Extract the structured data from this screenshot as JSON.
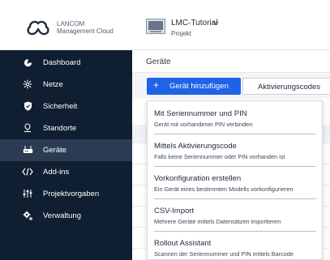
{
  "brand": {
    "line1": "LANCOM",
    "line2": "Management Cloud"
  },
  "project": {
    "name": "LMC-Tutorial",
    "subtitle": "Projekt",
    "chevron": "⌵"
  },
  "sidebar": {
    "items": [
      {
        "label": "Dashboard",
        "icon": "dashboard-gauge-icon",
        "active": false
      },
      {
        "label": "Netze",
        "icon": "network-icon",
        "active": false
      },
      {
        "label": "Sicherheit",
        "icon": "shield-icon",
        "active": false
      },
      {
        "label": "Standorte",
        "icon": "location-pin-icon",
        "active": false
      },
      {
        "label": "Geräte",
        "icon": "device-icon",
        "active": true
      },
      {
        "label": "Add-ins",
        "icon": "code-icon",
        "active": false
      },
      {
        "label": "Projektvorgaben",
        "icon": "sliders-icon",
        "active": false
      },
      {
        "label": "Verwaltung",
        "icon": "gears-icon",
        "active": false
      }
    ]
  },
  "main": {
    "breadcrumb": "Geräte",
    "add_button_label": "Gerät hinzufügen",
    "activation_button_label": "Aktivierungscodes"
  },
  "dropdown": {
    "items": [
      {
        "title": "Mit Seriennummer und PIN",
        "desc": "Gerät mit vorhandener PIN verbinden"
      },
      {
        "title": "Mittels Aktivierungscode",
        "desc": "Falls keine Seriennummer oder PIN vorhanden ist"
      },
      {
        "title": "Vorkonfiguration erstellen",
        "desc": "Ein Gerät eines bestimmten Modells vorkonfigurieren"
      },
      {
        "title": "CSV-Import",
        "desc": "Mehrere Geräte mittels Datensätzen importieren"
      },
      {
        "title": "Rollout Assistant",
        "desc": "Scannen der Seriennummer und PIN mittels Barcode"
      }
    ]
  },
  "colors": {
    "sidebar_bg": "#0f1e31",
    "sidebar_active": "#2b3b52",
    "primary_button": "#1f63e6"
  }
}
